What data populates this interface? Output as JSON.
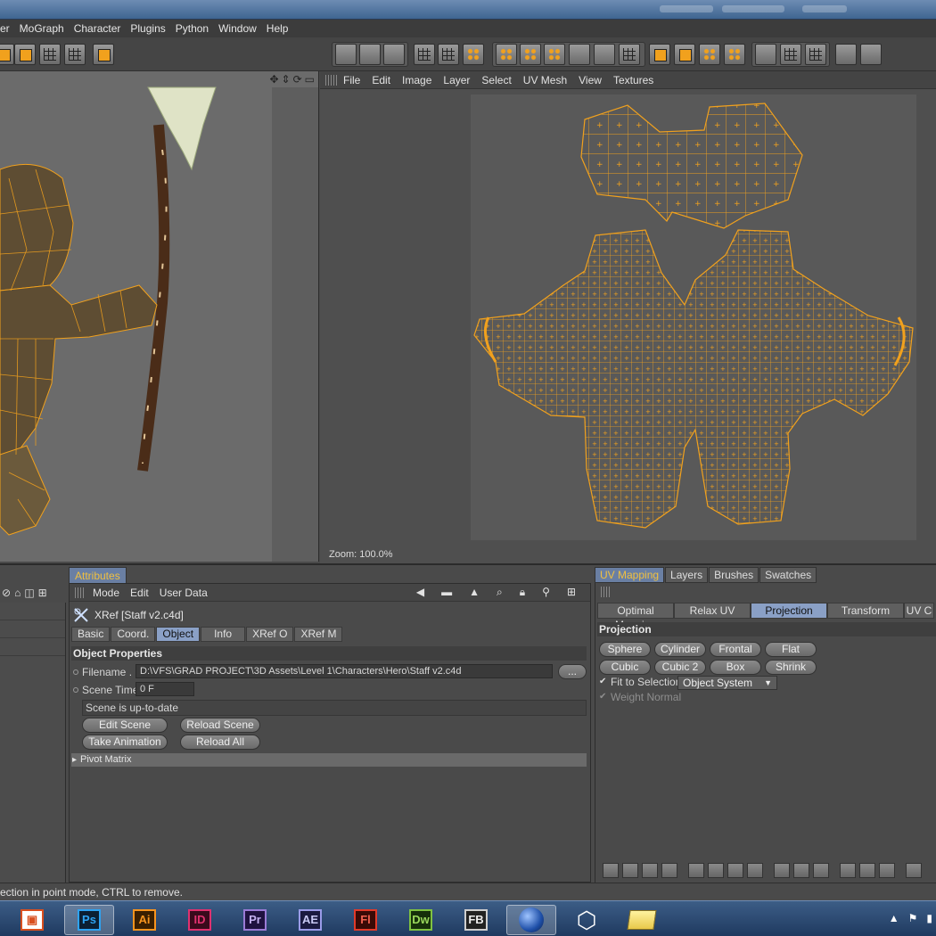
{
  "menubar": {
    "items": [
      "er",
      "MoGraph",
      "Character",
      "Plugins",
      "Python",
      "Window",
      "Help"
    ]
  },
  "viewport": {
    "header_icons": [
      "move-icon",
      "zoom-icon",
      "rotate-icon",
      "maximize-icon"
    ]
  },
  "uv_editor": {
    "menu": [
      "File",
      "Edit",
      "Image",
      "Layer",
      "Select",
      "UV Mesh",
      "View",
      "Textures"
    ],
    "zoom_label": "Zoom: 100.0%"
  },
  "attributes": {
    "tab_label": "Attributes",
    "menu": [
      "Mode",
      "Edit",
      "User Data"
    ],
    "object_title": "XRef [Staff v2.c4d]",
    "tabs": [
      "Basic",
      "Coord.",
      "Object",
      "Info",
      "XRef O",
      "XRef M"
    ],
    "active_tab": "Object",
    "section_title": "Object Properties",
    "filename_label": "Filename . . .",
    "filename_value": "D:\\VFS\\GRAD PROJECT\\3D Assets\\Level 1\\Characters\\Hero\\Staff v2.c4d",
    "browse_label": "...",
    "scene_time_label": "Scene Time",
    "scene_time_value": "0 F",
    "status_text": "Scene is up-to-date",
    "buttons": {
      "edit_scene": "Edit Scene",
      "reload_scene": "Reload Scene",
      "take_animation": "Take Animation",
      "reload_all": "Reload All"
    },
    "pivot_label": "Pivot Matrix"
  },
  "uv_mapping": {
    "tabs": [
      "UV Mapping",
      "Layers",
      "Brushes",
      "Swatches"
    ],
    "active_tab": "UV Mapping",
    "subtabs": [
      "Optimal Mapping",
      "Relax UV",
      "Projection",
      "Transform",
      "UV C"
    ],
    "active_subtab": "Projection",
    "section_title": "Projection",
    "projection_buttons_row1": [
      "Sphere",
      "Cylinder",
      "Frontal",
      "Flat"
    ],
    "projection_buttons_row2": [
      "Cubic",
      "Cubic 2",
      "Box",
      "Shrink"
    ],
    "fit_to_selection_label": "Fit to Selection",
    "coordinate_dropdown": "Object System",
    "weight_normal_label": "Weight Normal"
  },
  "statusbar": {
    "text": "ection in point mode, CTRL to remove."
  },
  "taskbar": {
    "apps": [
      {
        "label": "",
        "color": "#d94f1f",
        "name": "office-app"
      },
      {
        "label": "Ps",
        "color": "#2ea3f2",
        "name": "photoshop-app"
      },
      {
        "label": "Ai",
        "color": "#f7941e",
        "name": "illustrator-app"
      },
      {
        "label": "ID",
        "color": "#e0316f",
        "name": "indesign-app"
      },
      {
        "label": "Pr",
        "color": "#9a7bd6",
        "name": "premiere-app"
      },
      {
        "label": "AE",
        "color": "#9a9be8",
        "name": "after-effects-app"
      },
      {
        "label": "Fl",
        "color": "#e23a2a",
        "name": "flash-app"
      },
      {
        "label": "Dw",
        "color": "#7fc241",
        "name": "dreamweaver-app"
      },
      {
        "label": "FB",
        "color": "#cfcfcf",
        "name": "flash-builder-app"
      }
    ]
  },
  "colors": {
    "accent_orange": "#f1a11d",
    "active_tab_blue": "#8aa0c6"
  }
}
